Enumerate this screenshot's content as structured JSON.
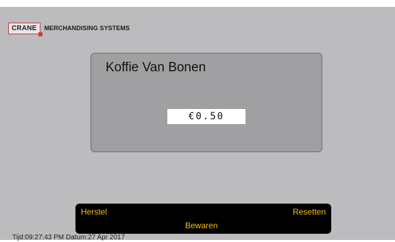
{
  "brand": {
    "logo_text": "CRANE",
    "company": "MERCHANDISING SYSTEMS"
  },
  "product": {
    "name": "Koffie Van Bonen",
    "price": "€0.50"
  },
  "actions": {
    "herstel_label": "Herstel",
    "resetten_label": "Resetten",
    "bewaren_label": "Bewaren"
  },
  "footer": {
    "datetime": "Tijd:09:27:43 PM Datum:27 Apr 2017"
  },
  "colors": {
    "screen_bg": "#bcbbbd",
    "panel_bg": "#a09fa1",
    "action_bar": "#000000",
    "action_text": "#f4c20d",
    "logo_border": "#d23a3a"
  }
}
